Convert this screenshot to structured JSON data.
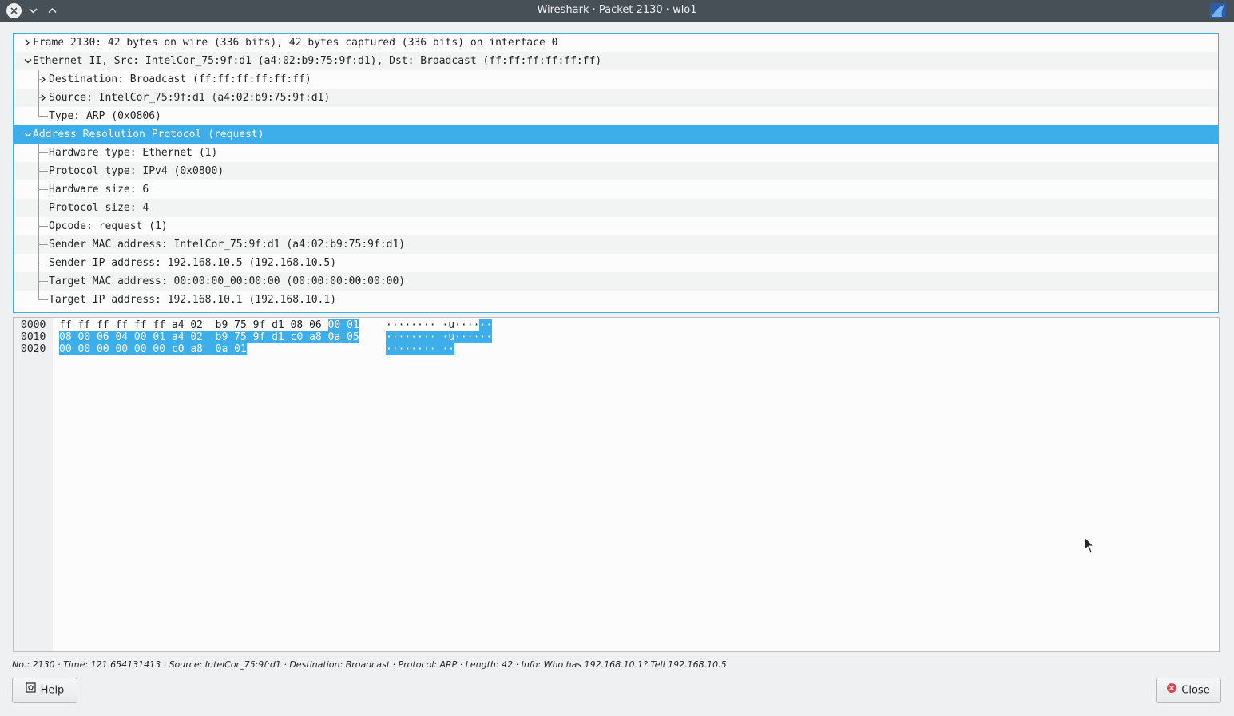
{
  "window": {
    "title": "Wireshark · Packet 2130 · wlo1",
    "brand_color": "#3daee9"
  },
  "tree": {
    "items": [
      {
        "label": "Frame 2130: 42 bytes on wire (336 bits), 42 bytes captured (336 bits) on interface 0",
        "level": 0,
        "state": "collapsed"
      },
      {
        "label": "Ethernet II, Src: IntelCor_75:9f:d1 (a4:02:b9:75:9f:d1), Dst: Broadcast (ff:ff:ff:ff:ff:ff)",
        "level": 0,
        "state": "expanded"
      },
      {
        "label": "Destination: Broadcast (ff:ff:ff:ff:ff:ff)",
        "level": 1,
        "state": "collapsed"
      },
      {
        "label": "Source: IntelCor_75:9f:d1 (a4:02:b9:75:9f:d1)",
        "level": 1,
        "state": "collapsed"
      },
      {
        "label": "Type: ARP (0x0806)",
        "level": 1,
        "state": "leaf"
      },
      {
        "label": "Address Resolution Protocol (request)",
        "level": 0,
        "state": "expanded",
        "selected": true
      },
      {
        "label": "Hardware type: Ethernet (1)",
        "level": 1,
        "state": "leaf"
      },
      {
        "label": "Protocol type: IPv4 (0x0800)",
        "level": 1,
        "state": "leaf"
      },
      {
        "label": "Hardware size: 6",
        "level": 1,
        "state": "leaf"
      },
      {
        "label": "Protocol size: 4",
        "level": 1,
        "state": "leaf"
      },
      {
        "label": "Opcode: request (1)",
        "level": 1,
        "state": "leaf"
      },
      {
        "label": "Sender MAC address: IntelCor_75:9f:d1 (a4:02:b9:75:9f:d1)",
        "level": 1,
        "state": "leaf"
      },
      {
        "label": "Sender IP address: 192.168.10.5 (192.168.10.5)",
        "level": 1,
        "state": "leaf"
      },
      {
        "label": "Target MAC address: 00:00:00_00:00:00 (00:00:00:00:00:00)",
        "level": 1,
        "state": "leaf"
      },
      {
        "label": "Target IP address: 192.168.10.1 (192.168.10.1)",
        "level": 1,
        "state": "leaf"
      }
    ]
  },
  "hex": {
    "lines": [
      {
        "offset": "0000",
        "hex_plain": "ff ff ff ff ff ff a4 02  b9 75 9f d1 08 06 ",
        "hex_sel": "00 01",
        "ascii_plain": "········ ·u····",
        "ascii_sel": "··"
      },
      {
        "offset": "0010",
        "hex_plain": "",
        "hex_sel": "08 00 06 04 00 01 a4 02  b9 75 9f d1 c0 a8 0a 05",
        "ascii_plain": "",
        "ascii_sel": "········ ·u······"
      },
      {
        "offset": "0020",
        "hex_plain": "",
        "hex_sel": "00 00 00 00 00 00 c0 a8  0a 01",
        "ascii_plain": "",
        "ascii_sel": "········ ··"
      }
    ]
  },
  "status": "No.: 2130 · Time: 121.654131413 · Source: IntelCor_75:9f:d1 · Destination: Broadcast · Protocol: ARP · Length: 42 · Info: Who has 192.168.10.1? Tell 192.168.10.5",
  "buttons": {
    "help": "Help",
    "close": "Close"
  },
  "icons": {
    "close_window": "close-circle-icon",
    "minimize": "chevron-down-icon",
    "maximize": "chevron-up-icon",
    "app": "wireshark-fin-icon",
    "help": "gear-help-icon",
    "close_button": "close-red-icon"
  }
}
